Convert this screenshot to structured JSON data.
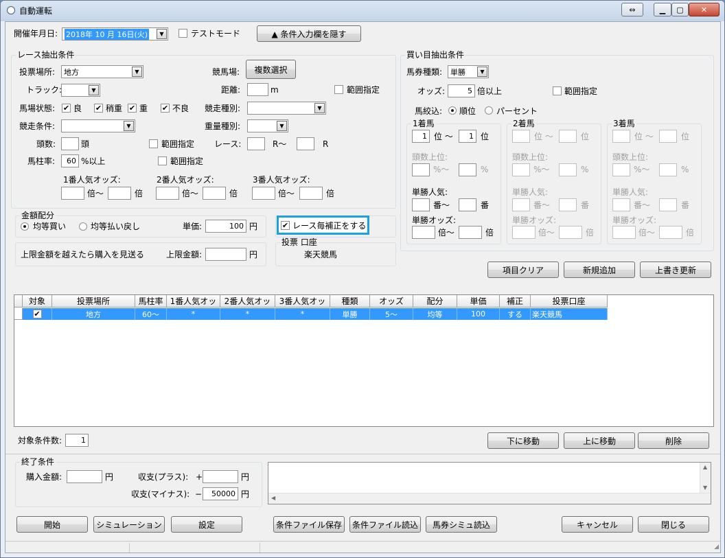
{
  "window": {
    "title": "自動運転"
  },
  "top": {
    "date_label": "開催年月日:",
    "date_value": "2018年 10 月 16日(火)",
    "test_mode_label": "テストモード",
    "hide_conditions_label": "▲ 条件入力欄を隠す"
  },
  "race": {
    "group_title": "レース抽出条件",
    "venue_label": "投票場所:",
    "venue_value": "地方",
    "track_label": "トラック:",
    "condition_label": "馬場状態:",
    "cond_good": "良",
    "cond_slightly_heavy": "稍重",
    "cond_heavy": "重",
    "cond_bad": "不良",
    "race_cond_label": "競走条件:",
    "heads_label": "頭数:",
    "heads_unit": "頭",
    "range_label": "範囲指定",
    "post_rate_label": "馬柱率:",
    "post_rate_value": "60",
    "post_rate_unit": "%以上",
    "racecourse_label": "競馬場:",
    "multi_select_label": "複数選択",
    "distance_label": "距離:",
    "distance_unit": "m",
    "race_type_label": "競走種別:",
    "weight_type_label": "重量種別:",
    "race_no_label": "レース:",
    "race_from_unit": "R〜",
    "race_to_unit": "R",
    "odds1_label": "1番人気オッズ:",
    "odds2_label": "2番人気オッズ:",
    "odds3_label": "3番人気オッズ:",
    "times_from": "倍〜",
    "times": "倍"
  },
  "money": {
    "group_title": "金額配分",
    "equal_buy": "均等買い",
    "equal_pay": "均等払い戻し",
    "unit_price_label": "単価:",
    "unit_price_value": "100",
    "yen": "円",
    "per_race_label": "レース毎補正をする",
    "limit_text": "上限金額を越えたら購入を見送る",
    "limit_label": "上限金額:"
  },
  "account": {
    "group_title": "投票 口座",
    "value": "楽天競馬"
  },
  "buy": {
    "group_title": "買い目抽出条件",
    "ticket_label": "馬券種類:",
    "ticket_value": "単勝",
    "odds_label": "オッズ:",
    "odds_value": "5",
    "odds_unit": "倍以上",
    "range_label": "範囲指定",
    "narrow_label": "馬絞込:",
    "rank_label": "順位",
    "percent_label": "パーセント",
    "places": [
      {
        "title": "1着馬",
        "from": "1",
        "to": "1",
        "pos_from": "位 〜",
        "pos_to": "位",
        "heads_top": "頭数上位:",
        "pct_from": "%〜",
        "pct": "%",
        "pop": "単勝人気:",
        "ban_from": "番〜",
        "ban": "番",
        "win_odds": "単勝オッズ:",
        "bai_from": "倍〜",
        "bai": "倍"
      },
      {
        "title": "2着馬",
        "from": "",
        "to": "",
        "pos_from": "位 〜",
        "pos_to": "位",
        "heads_top": "頭数上位:",
        "pct_from": "%〜",
        "pct": "%",
        "pop": "単勝人気:",
        "ban_from": "番〜",
        "ban": "番",
        "win_odds": "単勝オッズ:",
        "bai_from": "倍〜",
        "bai": "倍"
      },
      {
        "title": "3着馬",
        "from": "",
        "to": "",
        "pos_from": "位 〜",
        "pos_to": "位",
        "heads_top": "頭数上位:",
        "pct_from": "%〜",
        "pct": "%",
        "pop": "単勝人気:",
        "ban_from": "番〜",
        "ban": "番",
        "win_odds": "単勝オッズ:",
        "bai_from": "倍〜",
        "bai": "倍"
      }
    ]
  },
  "actions": {
    "clear": "項目クリア",
    "add": "新規追加",
    "overwrite": "上書き更新"
  },
  "table": {
    "headers": [
      "対象",
      "投票場所",
      "馬柱率",
      "1番人気オッ",
      "2番人気オッ",
      "3番人気オッ",
      "種類",
      "オッズ",
      "配分",
      "単価",
      "補正",
      "投票口座"
    ],
    "rows": [
      {
        "checked": "✔",
        "cells": [
          "地方",
          "60〜",
          "*",
          "*",
          "*",
          "単勝",
          "5〜",
          "均等",
          "100",
          "する",
          "楽天競馬"
        ]
      }
    ]
  },
  "list_footer": {
    "count_label": "対象条件数:",
    "count_value": "1",
    "move_down": "下に移動",
    "move_up": "上に移動",
    "delete": "削除"
  },
  "end": {
    "group_title": "終了条件",
    "purchase_label": "購入金額:",
    "yen": "円",
    "plus_label": "収支(プラス):",
    "plus_sign": "+",
    "minus_label": "収支(マイナス):",
    "minus_sign": "−",
    "minus_value": "50000"
  },
  "bottom": {
    "start": "開始",
    "simulation": "シミュレーション",
    "settings": "設定",
    "save_file": "条件ファイル保存",
    "load_file": "条件ファイル読込",
    "load_sim": "馬券シミュ読込",
    "cancel": "キャンセル",
    "close": "閉じる"
  },
  "colors": {
    "selection": "#3399ff",
    "highlight_border": "#1ba1e2"
  }
}
